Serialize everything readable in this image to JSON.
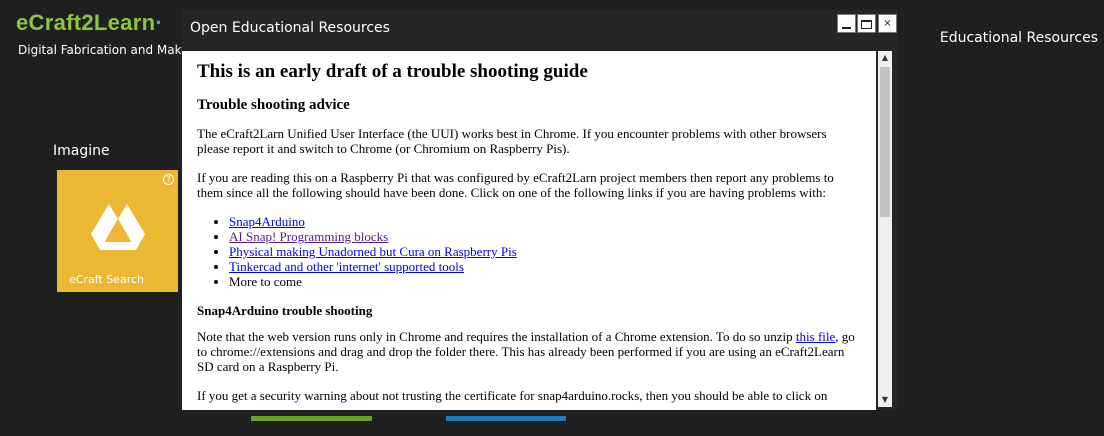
{
  "brand": {
    "logo_main": "eCraft2Learn",
    "logo_dot": "·",
    "subtitle": "Digital Fabrication and Maker Mo"
  },
  "header": {
    "right_label": "Educational Resources"
  },
  "section": {
    "label": "Imagine"
  },
  "tile": {
    "label": "eCraft Search",
    "help_glyph": "?",
    "color": "#ebb834"
  },
  "dialog": {
    "title": "Open Educational Resources",
    "close_glyph": "×",
    "doc": {
      "h1": "This is an early draft of a trouble shooting guide",
      "h2": "Trouble shooting advice",
      "p1": "The eCraft2Larn Unified User Interface (the UUI) works best in Chrome. If you encounter problems with other browsers please report it and switch to Chrome (or Chromium on Raspberry Pis).",
      "p2": "If you are reading this on a Raspberry Pi that was configured by eCraft2Larn project members then report any problems to them since all the following should have been done. Click on one of the following links if you are having problems with:",
      "links": [
        {
          "text": "Snap4Arduino",
          "visited": false
        },
        {
          "text": "AI Snap! Programming blocks",
          "visited": true
        },
        {
          "text": "Physical making Unadorned but Cura on Raspberry Pis",
          "visited": false
        },
        {
          "text": "Tinkercad and other 'internet' supported tools",
          "visited": false
        }
      ],
      "more": "More to come",
      "h3": "Snap4Arduino trouble shooting",
      "p3_before": "Note that the web version runs only in Chrome and requires the installation of a Chrome extension. To do so unzip ",
      "p3_link": "this file",
      "p3_after": ", go to chrome://extensions and drag and drop the folder there. This has already been performed if you are using an eCraft2Learn SD card on a Raspberry Pi.",
      "p4": "If you get a security warning about not trusting the certificate for snap4arduino.rocks, then you should be able to click on"
    }
  },
  "scrollbar": {
    "up_glyph": "▲",
    "down_glyph": "▼"
  },
  "colors": {
    "logo_green": "#8cc63f",
    "accent_blue": "#29abe2",
    "bar_green": "#6aa329",
    "bar_blue": "#1f7dbf"
  }
}
